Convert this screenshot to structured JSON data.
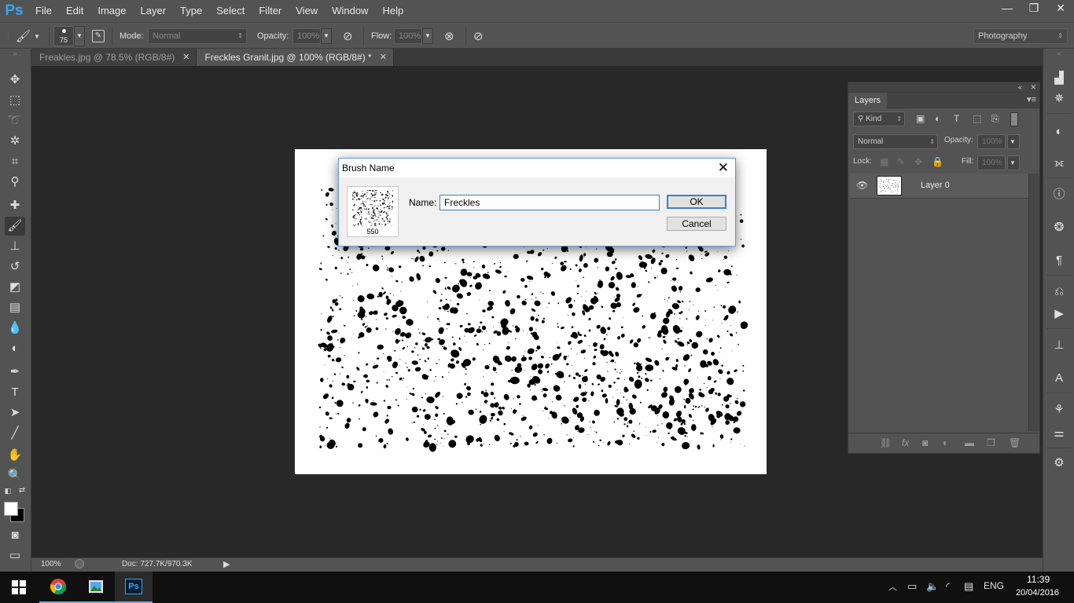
{
  "app": {
    "logo": "Ps"
  },
  "menu": [
    "File",
    "Edit",
    "Image",
    "Layer",
    "Type",
    "Select",
    "Filter",
    "View",
    "Window",
    "Help"
  ],
  "window_controls": {
    "minimize": "—",
    "restore": "❐",
    "close": "✕"
  },
  "options": {
    "brush_size": "75",
    "mode_label": "Mode:",
    "mode_value": "Normal",
    "opacity_label": "Opacity:",
    "opacity_value": "100%",
    "flow_label": "Flow:",
    "flow_value": "100%",
    "workspace": "Photography"
  },
  "tabs": [
    {
      "label": "Freakles.jpg @ 78.5% (RGB/8#)",
      "close": "✕",
      "active": false
    },
    {
      "label": "Freckles Granit.jpg @ 100% (RGB/8#) *",
      "close": "✕",
      "active": true
    }
  ],
  "status": {
    "zoom": "100%",
    "doc": "Doc: 727.7K/970.3K",
    "arrow": "▶"
  },
  "layers_panel": {
    "tab": "Layers",
    "filter_kind": "Kind",
    "blend_mode": "Normal",
    "opacity_label": "Opacity:",
    "opacity_value": "100%",
    "lock_label": "Lock:",
    "fill_label": "Fill:",
    "fill_value": "100%",
    "layers": [
      {
        "name": "Layer 0",
        "visible": true
      }
    ]
  },
  "dialog": {
    "title": "Brush Name",
    "close": "✕",
    "brush_size": "550",
    "name_label": "Name:",
    "name_value": "Freckles",
    "ok": "OK",
    "cancel": "Cancel"
  },
  "taskbar": {
    "language": "ENG",
    "time": "11:39",
    "date": "20/04/2016"
  },
  "colors": {
    "accent": "#31a8ff",
    "panel": "#535353",
    "workspace": "#282828",
    "dialog_focus": "#3c7fd0"
  }
}
